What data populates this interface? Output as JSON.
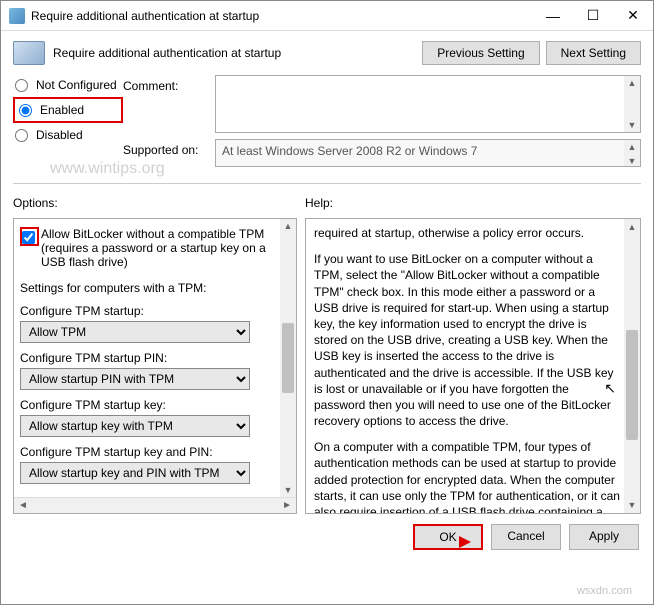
{
  "window": {
    "title": "Require additional authentication at startup",
    "heading": "Require additional authentication at startup"
  },
  "nav": {
    "previous": "Previous Setting",
    "next": "Next Setting"
  },
  "states": {
    "not_configured": "Not Configured",
    "enabled": "Enabled",
    "disabled": "Disabled"
  },
  "fields": {
    "comment_label": "Comment:",
    "supported_label": "Supported on:",
    "supported_value": "At least Windows Server 2008 R2 or Windows 7"
  },
  "panels": {
    "options": "Options:",
    "help": "Help:"
  },
  "options": {
    "allow_no_tpm": "Allow BitLocker without a compatible TPM (requires a password or a startup key on a USB flash drive)",
    "tpm_settings_header": "Settings for computers with a TPM:",
    "tpm_startup_label": "Configure TPM startup:",
    "tpm_startup_value": "Allow TPM",
    "tpm_pin_label": "Configure TPM startup PIN:",
    "tpm_pin_value": "Allow startup PIN with TPM",
    "tpm_key_label": "Configure TPM startup key:",
    "tpm_key_value": "Allow startup key with TPM",
    "tpm_keypin_label": "Configure TPM startup key and PIN:",
    "tpm_keypin_value": "Allow startup key and PIN with TPM"
  },
  "help": {
    "p1": "required at startup, otherwise a policy error occurs.",
    "p2": "If you want to use BitLocker on a computer without a TPM, select the \"Allow BitLocker without a compatible TPM\" check box. In this mode either a password or a USB drive is required for start-up. When using a startup key, the key information used to encrypt the drive is stored on the USB drive, creating a USB key. When the USB key is inserted the access to the drive is authenticated and the drive is accessible. If the USB key is lost or unavailable or if you have forgotten the password then you will need to use one of the BitLocker recovery options to access the drive.",
    "p3": "On a computer with a compatible TPM, four types of authentication methods can be used at startup to provide added protection for encrypted data. When the computer starts, it can use only the TPM for authentication, or it can also require insertion of a USB flash drive containing a startup key, the entry of a 6-digit to 20-digit personal identification number (PIN), or both."
  },
  "buttons": {
    "ok": "OK",
    "cancel": "Cancel",
    "apply": "Apply"
  },
  "watermarks": {
    "w1": "www.wintips.org",
    "w2": "wsxdn.com"
  }
}
